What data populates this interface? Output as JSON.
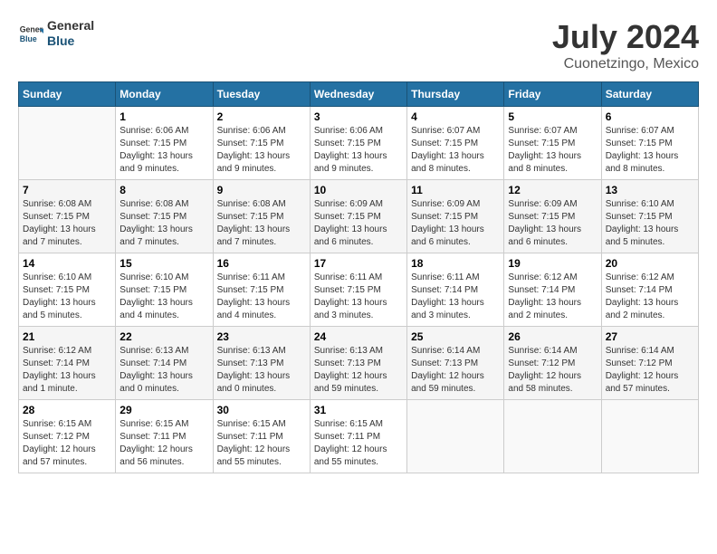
{
  "header": {
    "logo_general": "General",
    "logo_blue": "Blue",
    "month_title": "July 2024",
    "location": "Cuonetzingo, Mexico"
  },
  "days_of_week": [
    "Sunday",
    "Monday",
    "Tuesday",
    "Wednesday",
    "Thursday",
    "Friday",
    "Saturday"
  ],
  "weeks": [
    [
      {
        "num": "",
        "info": ""
      },
      {
        "num": "1",
        "info": "Sunrise: 6:06 AM\nSunset: 7:15 PM\nDaylight: 13 hours and 9 minutes."
      },
      {
        "num": "2",
        "info": "Sunrise: 6:06 AM\nSunset: 7:15 PM\nDaylight: 13 hours and 9 minutes."
      },
      {
        "num": "3",
        "info": "Sunrise: 6:06 AM\nSunset: 7:15 PM\nDaylight: 13 hours and 9 minutes."
      },
      {
        "num": "4",
        "info": "Sunrise: 6:07 AM\nSunset: 7:15 PM\nDaylight: 13 hours and 8 minutes."
      },
      {
        "num": "5",
        "info": "Sunrise: 6:07 AM\nSunset: 7:15 PM\nDaylight: 13 hours and 8 minutes."
      },
      {
        "num": "6",
        "info": "Sunrise: 6:07 AM\nSunset: 7:15 PM\nDaylight: 13 hours and 8 minutes."
      }
    ],
    [
      {
        "num": "7",
        "info": "Sunrise: 6:08 AM\nSunset: 7:15 PM\nDaylight: 13 hours and 7 minutes."
      },
      {
        "num": "8",
        "info": "Sunrise: 6:08 AM\nSunset: 7:15 PM\nDaylight: 13 hours and 7 minutes."
      },
      {
        "num": "9",
        "info": "Sunrise: 6:08 AM\nSunset: 7:15 PM\nDaylight: 13 hours and 7 minutes."
      },
      {
        "num": "10",
        "info": "Sunrise: 6:09 AM\nSunset: 7:15 PM\nDaylight: 13 hours and 6 minutes."
      },
      {
        "num": "11",
        "info": "Sunrise: 6:09 AM\nSunset: 7:15 PM\nDaylight: 13 hours and 6 minutes."
      },
      {
        "num": "12",
        "info": "Sunrise: 6:09 AM\nSunset: 7:15 PM\nDaylight: 13 hours and 6 minutes."
      },
      {
        "num": "13",
        "info": "Sunrise: 6:10 AM\nSunset: 7:15 PM\nDaylight: 13 hours and 5 minutes."
      }
    ],
    [
      {
        "num": "14",
        "info": "Sunrise: 6:10 AM\nSunset: 7:15 PM\nDaylight: 13 hours and 5 minutes."
      },
      {
        "num": "15",
        "info": "Sunrise: 6:10 AM\nSunset: 7:15 PM\nDaylight: 13 hours and 4 minutes."
      },
      {
        "num": "16",
        "info": "Sunrise: 6:11 AM\nSunset: 7:15 PM\nDaylight: 13 hours and 4 minutes."
      },
      {
        "num": "17",
        "info": "Sunrise: 6:11 AM\nSunset: 7:15 PM\nDaylight: 13 hours and 3 minutes."
      },
      {
        "num": "18",
        "info": "Sunrise: 6:11 AM\nSunset: 7:14 PM\nDaylight: 13 hours and 3 minutes."
      },
      {
        "num": "19",
        "info": "Sunrise: 6:12 AM\nSunset: 7:14 PM\nDaylight: 13 hours and 2 minutes."
      },
      {
        "num": "20",
        "info": "Sunrise: 6:12 AM\nSunset: 7:14 PM\nDaylight: 13 hours and 2 minutes."
      }
    ],
    [
      {
        "num": "21",
        "info": "Sunrise: 6:12 AM\nSunset: 7:14 PM\nDaylight: 13 hours and 1 minute."
      },
      {
        "num": "22",
        "info": "Sunrise: 6:13 AM\nSunset: 7:14 PM\nDaylight: 13 hours and 0 minutes."
      },
      {
        "num": "23",
        "info": "Sunrise: 6:13 AM\nSunset: 7:13 PM\nDaylight: 13 hours and 0 minutes."
      },
      {
        "num": "24",
        "info": "Sunrise: 6:13 AM\nSunset: 7:13 PM\nDaylight: 12 hours and 59 minutes."
      },
      {
        "num": "25",
        "info": "Sunrise: 6:14 AM\nSunset: 7:13 PM\nDaylight: 12 hours and 59 minutes."
      },
      {
        "num": "26",
        "info": "Sunrise: 6:14 AM\nSunset: 7:12 PM\nDaylight: 12 hours and 58 minutes."
      },
      {
        "num": "27",
        "info": "Sunrise: 6:14 AM\nSunset: 7:12 PM\nDaylight: 12 hours and 57 minutes."
      }
    ],
    [
      {
        "num": "28",
        "info": "Sunrise: 6:15 AM\nSunset: 7:12 PM\nDaylight: 12 hours and 57 minutes."
      },
      {
        "num": "29",
        "info": "Sunrise: 6:15 AM\nSunset: 7:11 PM\nDaylight: 12 hours and 56 minutes."
      },
      {
        "num": "30",
        "info": "Sunrise: 6:15 AM\nSunset: 7:11 PM\nDaylight: 12 hours and 55 minutes."
      },
      {
        "num": "31",
        "info": "Sunrise: 6:15 AM\nSunset: 7:11 PM\nDaylight: 12 hours and 55 minutes."
      },
      {
        "num": "",
        "info": ""
      },
      {
        "num": "",
        "info": ""
      },
      {
        "num": "",
        "info": ""
      }
    ]
  ]
}
